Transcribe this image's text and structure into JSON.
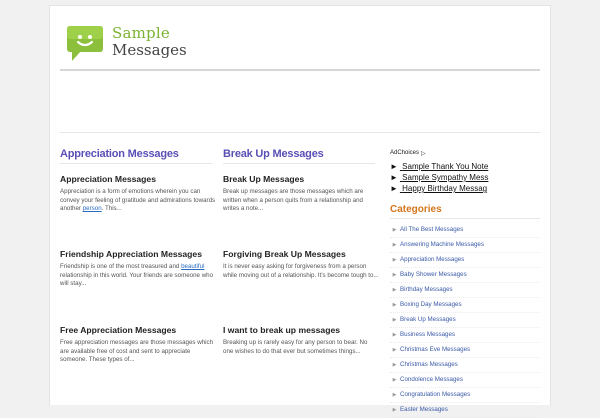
{
  "logo": {
    "line1": "Sample",
    "line2": "Messages"
  },
  "columns": [
    {
      "heading": "Appreciation Messages",
      "posts": [
        {
          "title": "Appreciation Messages",
          "text_before": "Appreciation is a form of emotions wherein you can convey your feeling of gratitude and admirations towards another ",
          "link": "person",
          "text_after": ". This..."
        },
        {
          "title": "Friendship Appreciation Messages",
          "text_before": "Friendship is one of the most treasured and ",
          "link": "beautiful",
          "text_after": " relationship in this world. Your friends are someone who will stay..."
        },
        {
          "title": "Free Appreciation Messages",
          "text_before": "Free appreciation messages are those messages which are available free of cost and sent to appreciate someone. These types of...",
          "link": "",
          "text_after": ""
        }
      ]
    },
    {
      "heading": "Break Up Messages",
      "posts": [
        {
          "title": "Break Up Messages",
          "text_before": "Break up messages are those messages which are written when a person quits from a relationship and writes a note...",
          "link": "",
          "text_after": ""
        },
        {
          "title": "Forgiving Break Up Messages",
          "text_before": "It is never easy asking for forgiveness from a person while moving out of a relationship. It's become tough to...",
          "link": "",
          "text_after": ""
        },
        {
          "title": "I want to break up messages",
          "text_before": "Breaking up is rarely easy for any person to bear. No one wishes to do that ever but sometimes things...",
          "link": "",
          "text_after": ""
        }
      ]
    }
  ],
  "sidebar": {
    "adchoices_label": "AdChoices",
    "ad_arrow": "►",
    "ad_links": [
      "Sample Thank You Note",
      "Sample Sympathy Mess",
      "Happy Birthday Messag"
    ],
    "categories_heading": "Categories",
    "categories": [
      "All The Best Messages",
      "Answering Machine Messages",
      "Appreciation Messages",
      "Baby Shower Messages",
      "Birthday Messages",
      "Boxing Day Messages",
      "Break Up Messages",
      "Business Messages",
      "Christmas Eve Messages",
      "Christmas Messages",
      "Condolence Messages",
      "Congratulation Messages",
      "Easter Messages"
    ]
  },
  "colors": {
    "heading": "#5a4fb5",
    "categories_heading": "#d3761c",
    "logo_green": "#7cb233",
    "link": "#3a5aa8"
  }
}
